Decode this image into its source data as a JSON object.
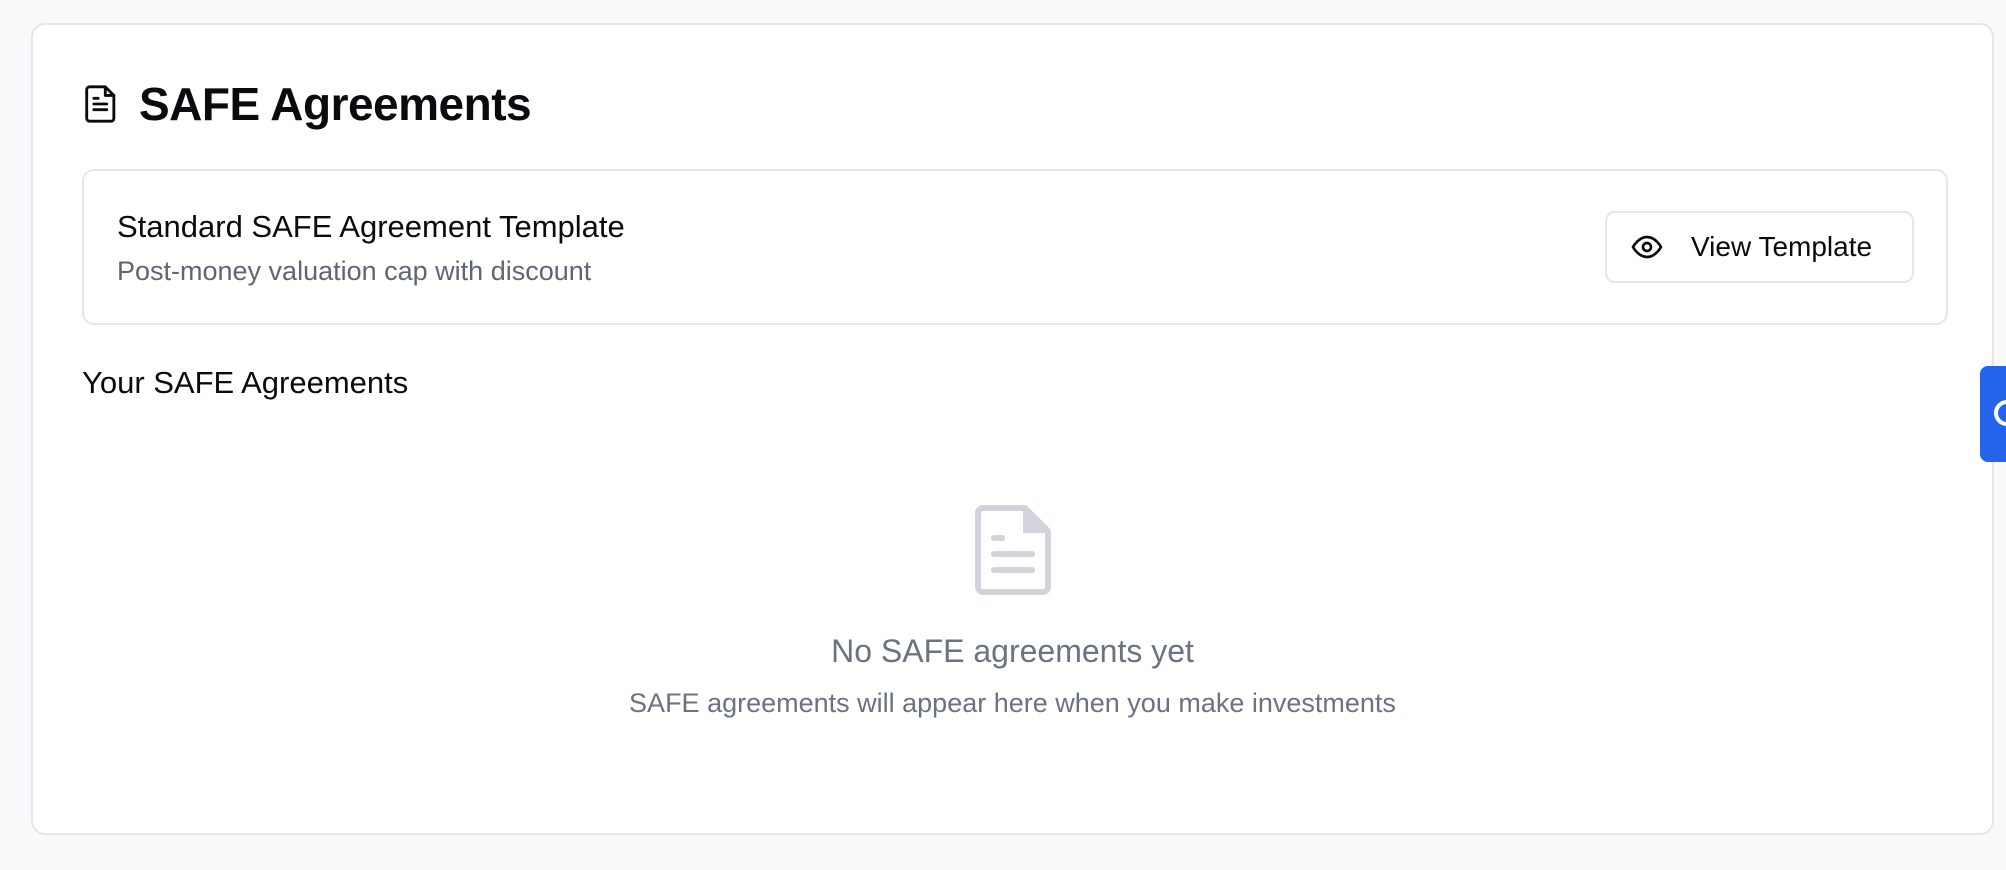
{
  "header": {
    "title": "SAFE Agreements",
    "icon": "document-icon"
  },
  "template": {
    "title": "Standard SAFE Agreement Template",
    "description": "Post-money valuation cap with discount",
    "button_label": "View Template",
    "button_icon": "eye-icon"
  },
  "agreements": {
    "section_title": "Your SAFE Agreements",
    "empty_icon": "document-icon",
    "empty_title": "No SAFE agreements yet",
    "empty_description": "SAFE agreements will appear here when you make investments"
  },
  "side_tab": {
    "icon": "chat-icon",
    "color": "#2563eb"
  }
}
